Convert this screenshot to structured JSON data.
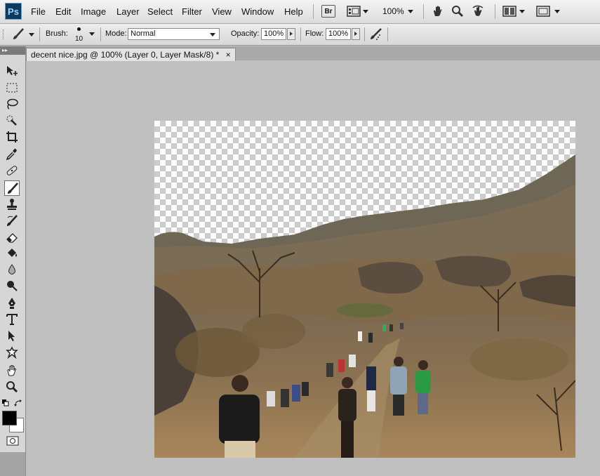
{
  "menubar": {
    "logo": "Ps",
    "menus": [
      "File",
      "Edit",
      "Image",
      "Layer",
      "Select",
      "Filter",
      "View",
      "Window",
      "Help"
    ],
    "bridge_label": "Br",
    "zoom": "100%"
  },
  "options": {
    "brush_label": "Brush:",
    "brush_size": "10",
    "mode_label": "Mode:",
    "mode_value": "Normal",
    "opacity_label": "Opacity:",
    "opacity_value": "100%",
    "flow_label": "Flow:",
    "flow_value": "100%"
  },
  "document": {
    "tab_title": "decent nice.jpg @ 100% (Layer 0, Layer Mask/8) *",
    "close_glyph": "×"
  },
  "colors": {
    "foreground": "#000000",
    "background": "#ffffff"
  }
}
